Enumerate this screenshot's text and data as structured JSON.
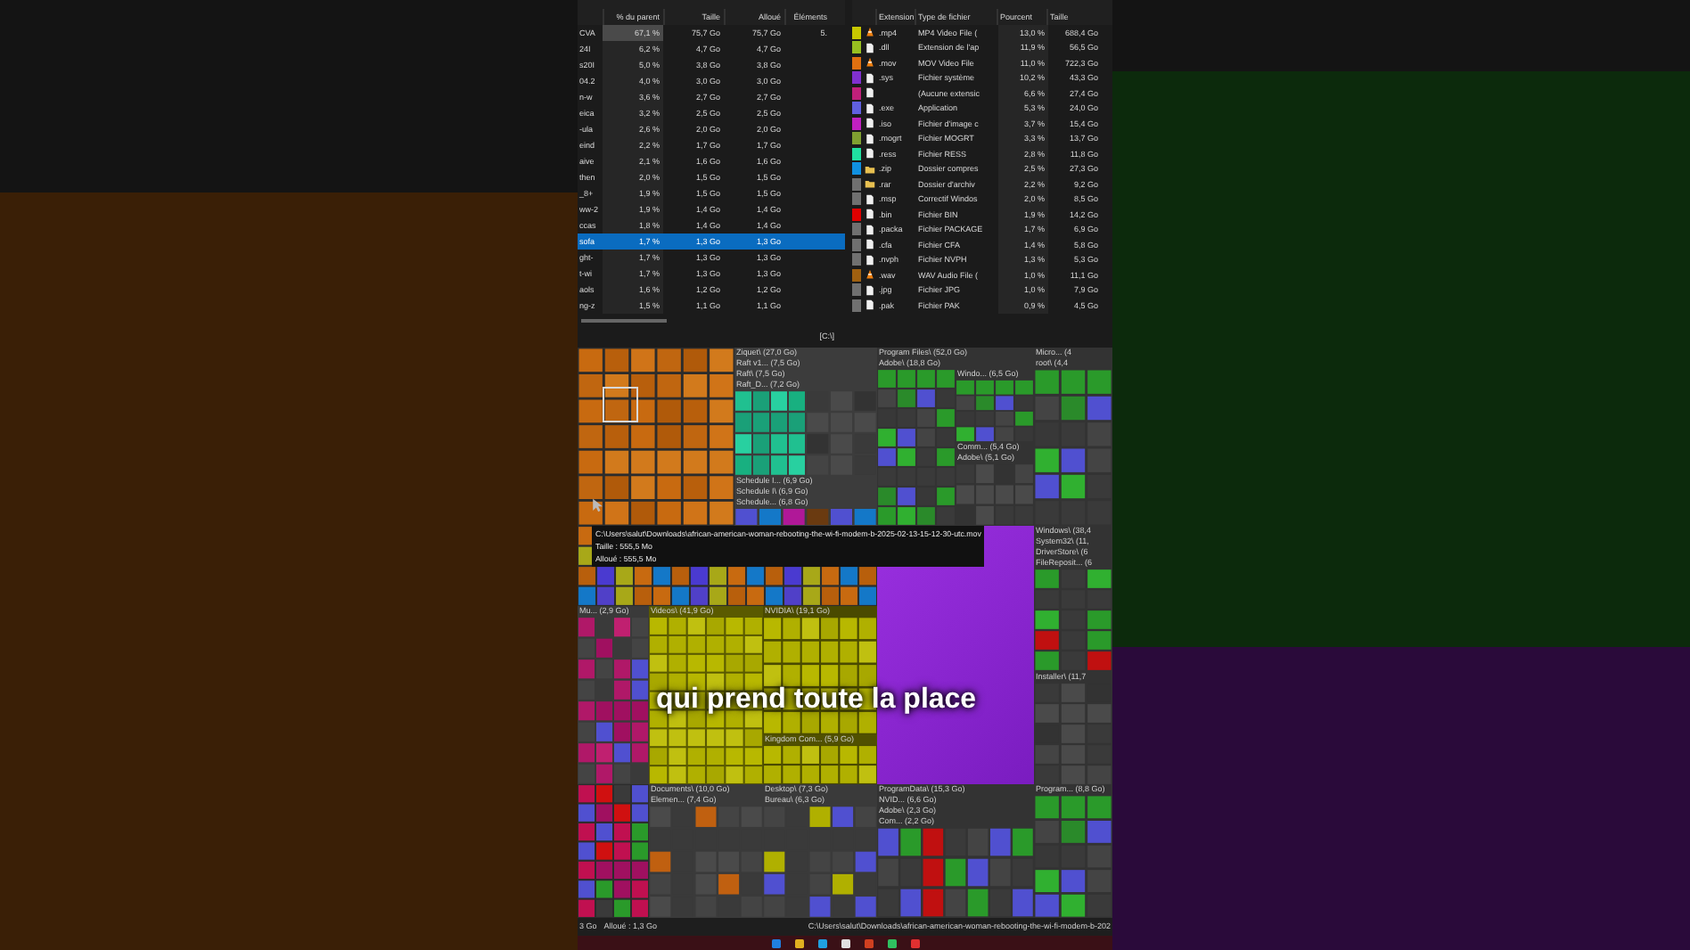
{
  "folder_table": {
    "columns": [
      "% du parent",
      "Taille",
      "Alloué",
      "Éléments"
    ],
    "rows": [
      {
        "name": "CVA",
        "percent": "67,1 %",
        "size": "75,7 Go",
        "allocated": "75,7 Go",
        "items": "5.",
        "selected": false
      },
      {
        "name": "24I",
        "percent": "6,2 %",
        "size": "4,7 Go",
        "allocated": "4,7 Go",
        "selected": false
      },
      {
        "name": "s20I",
        "percent": "5,0 %",
        "size": "3,8 Go",
        "allocated": "3,8 Go",
        "selected": false
      },
      {
        "name": "04.2",
        "percent": "4,0 %",
        "size": "3,0 Go",
        "allocated": "3,0 Go",
        "selected": false
      },
      {
        "name": "n-w",
        "percent": "3,6 %",
        "size": "2,7 Go",
        "allocated": "2,7 Go",
        "selected": false
      },
      {
        "name": "eica",
        "percent": "3,2 %",
        "size": "2,5 Go",
        "allocated": "2,5 Go",
        "selected": false
      },
      {
        "name": "-ula",
        "percent": "2,6 %",
        "size": "2,0 Go",
        "allocated": "2,0 Go",
        "selected": false
      },
      {
        "name": "eind",
        "percent": "2,2 %",
        "size": "1,7 Go",
        "allocated": "1,7 Go",
        "selected": false
      },
      {
        "name": "aive",
        "percent": "2,1 %",
        "size": "1,6 Go",
        "allocated": "1,6 Go",
        "selected": false
      },
      {
        "name": "then",
        "percent": "2,0 %",
        "size": "1,5 Go",
        "allocated": "1,5 Go",
        "selected": false
      },
      {
        "name": "_8+",
        "percent": "1,9 %",
        "size": "1,5 Go",
        "allocated": "1,5 Go",
        "selected": false
      },
      {
        "name": "ww-2",
        "percent": "1,9 %",
        "size": "1,4 Go",
        "allocated": "1,4 Go",
        "selected": false
      },
      {
        "name": "ccas",
        "percent": "1,8 %",
        "size": "1,4 Go",
        "allocated": "1,4 Go",
        "selected": false
      },
      {
        "name": "sofa",
        "percent": "1,7 %",
        "size": "1,3 Go",
        "allocated": "1,3 Go",
        "selected": true
      },
      {
        "name": "ght-",
        "percent": "1,7 %",
        "size": "1,3 Go",
        "allocated": "1,3 Go",
        "selected": false
      },
      {
        "name": "t-wi",
        "percent": "1,7 %",
        "size": "1,3 Go",
        "allocated": "1,3 Go",
        "selected": false
      },
      {
        "name": "aols",
        "percent": "1,6 %",
        "size": "1,2 Go",
        "allocated": "1,2 Go",
        "selected": false
      },
      {
        "name": "ng-z",
        "percent": "1,5 %",
        "size": "1,1 Go",
        "allocated": "1,1 Go",
        "selected": false
      }
    ],
    "footer": "[C:\\]"
  },
  "extension_table": {
    "columns": [
      "Extension",
      "Type de fichier",
      "Pourcent",
      "Taille"
    ],
    "rows": [
      {
        "color": "#c8c800",
        "extension": ".mp4",
        "type": "MP4 Video File (",
        "percent": "13,0 %",
        "size": "688,4 Go"
      },
      {
        "color": "#98c020",
        "extension": ".dll",
        "type": "Extension de l'ap",
        "percent": "11,9 %",
        "size": "56,5 Go"
      },
      {
        "color": "#e07010",
        "extension": ".mov",
        "type": "MOV Video File",
        "percent": "11,0 %",
        "size": "722,3 Go"
      },
      {
        "color": "#8030d0",
        "extension": ".sys",
        "type": "Fichier système",
        "percent": "10,2 %",
        "size": "43,3 Go"
      },
      {
        "color": "#c0207a",
        "type": "(Aucune extensic",
        "percent": "6,6 %",
        "size": "27,4 Go"
      },
      {
        "color": "#6060e0",
        "extension": ".exe",
        "type": "Application",
        "percent": "5,3 %",
        "size": "24,0 Go"
      },
      {
        "color": "#c020c0",
        "extension": ".iso",
        "type": "Fichier d'image c",
        "percent": "3,7 %",
        "size": "15,4 Go"
      },
      {
        "color": "#80a030",
        "extension": ".mogrt",
        "type": "Fichier MOGRT",
        "percent": "3,3 %",
        "size": "13,7 Go"
      },
      {
        "color": "#20e0a0",
        "extension": ".ress",
        "type": "Fichier RESS",
        "percent": "2,8 %",
        "size": "11,8 Go"
      },
      {
        "color": "#1090e0",
        "extension": ".zip",
        "type": "Dossier compres",
        "percent": "2,5 %",
        "size": "27,3 Go"
      },
      {
        "color": "#707070",
        "extension": ".rar",
        "type": "Dossier d'archiv",
        "percent": "2,2 %",
        "size": "9,2 Go"
      },
      {
        "color": "#707070",
        "extension": ".msp",
        "type": "Correctif Windos",
        "percent": "2,0 %",
        "size": "8,5 Go"
      },
      {
        "color": "#e00000",
        "extension": ".bin",
        "type": "Fichier BIN",
        "percent": "1,9 %",
        "size": "14,2 Go"
      },
      {
        "color": "#707070",
        "extension": ".packa",
        "type": "Fichier PACKAGE",
        "percent": "1,7 %",
        "size": "6,9 Go"
      },
      {
        "color": "#707070",
        "extension": ".cfa",
        "type": "Fichier CFA",
        "percent": "1,4 %",
        "size": "5,8 Go"
      },
      {
        "color": "#707070",
        "extension": ".nvph",
        "type": "Fichier NVPH",
        "percent": "1,3 %",
        "size": "5,3 Go"
      },
      {
        "color": "#a06010",
        "extension": ".wav",
        "type": "WAV Audio File (",
        "percent": "1,0 %",
        "size": "11,1 Go"
      },
      {
        "color": "#707070",
        "extension": ".jpg",
        "type": "Fichier JPG",
        "percent": "1,0 %",
        "size": "7,9 Go"
      },
      {
        "color": "#707070",
        "extension": ".pak",
        "type": "Fichier PAK",
        "percent": "0,9 %",
        "size": "4,5 Go"
      }
    ]
  },
  "treemap": {
    "games": [
      "Ziquet\\ (27,0 Go)",
      "Raft v1... (7,5 Go)",
      "Raft\\ (7,5 Go)",
      "Raft_D... (7,2 Go)"
    ],
    "schedule": [
      "Schedule I... (6,9 Go)",
      "Schedule I\\ (6,9 Go)",
      "Schedule... (6,8 Go)"
    ],
    "program_files": [
      "Program Files\\ (52,0 Go)",
      "Adobe\\ (18,8 Go)"
    ],
    "windows_apps": [
      "Windo... (6,5 Go)"
    ],
    "common": [
      "Comm... (5,4 Go)",
      "Adobe\\ (5,1 Go)"
    ],
    "micro": [
      "Micro... (4",
      "root\\ (4,4"
    ],
    "windows": [
      "Windows\\ (38,4",
      "System32\\ (11,",
      "DriverStore\\ (6",
      "FileReposit... (6"
    ],
    "installer": [
      "Installer\\ (11,7"
    ],
    "music": [
      "Mu... (2,9 Go)"
    ],
    "videos": [
      "Videos\\ (41,9 Go)"
    ],
    "nvidia": [
      "NVIDIA\\ (19,1 Go)"
    ],
    "kingdom": [
      "Kingdom Com... (5,9 Go)"
    ],
    "documents": [
      "Documents\\ (10,0 Go)",
      "Elemen... (7,4 Go)"
    ],
    "desktop": [
      "Desktop\\ (7,3 Go)",
      "Bureau\\ (6,3 Go)"
    ],
    "program_data": [
      "ProgramData\\ (15,3 Go)",
      "NVID... (6,6 Go)",
      "Adobe\\ (2,3 Go)",
      "Com... (2,2 Go)"
    ],
    "program": [
      "Program... (8,8 Go)"
    ]
  },
  "tooltip": [
    "C:\\Users\\salut\\Downloads\\african-american-woman-rebooting-the-wi-fi-modem-b-2025-02-13-15-12-30-utc.mov",
    "Taille : 555,5 Mo",
    "Alloué : 555,5 Mo"
  ],
  "caption": "qui prend toute la place",
  "status_bar": {
    "size": "3 Go",
    "allocated": "Alloué : 1,3 Go",
    "path": "C:\\Users\\salut\\Downloads\\african-american-woman-rebooting-the-wi-fi-modem-b-202"
  }
}
